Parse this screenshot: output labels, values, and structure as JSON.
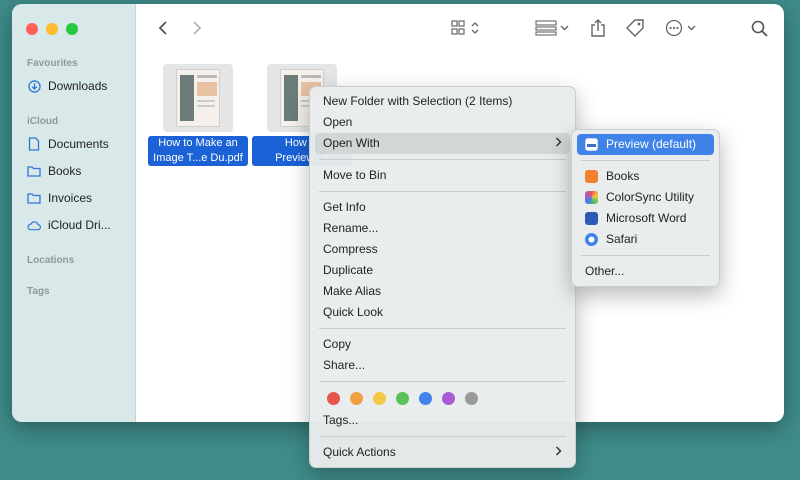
{
  "sidebar": {
    "favourites_title": "Favourites",
    "icloud_title": "iCloud",
    "locations_title": "Locations",
    "tags_title": "Tags",
    "items": [
      {
        "label": "Downloads",
        "icon": "download-circle-icon"
      },
      {
        "label": "Documents",
        "icon": "document-icon"
      },
      {
        "label": "Books",
        "icon": "folder-icon"
      },
      {
        "label": "Invoices",
        "icon": "folder-icon"
      },
      {
        "label": "iCloud Dri...",
        "icon": "cloud-icon"
      }
    ]
  },
  "files": [
    {
      "name": "How to Make an\nImage T...e Du.pdf"
    },
    {
      "name": "How to\nPreview...d"
    }
  ],
  "context_menu": {
    "new_folder": "New Folder with Selection (2 Items)",
    "open": "Open",
    "open_with": "Open With",
    "move_to_bin": "Move to Bin",
    "get_info": "Get Info",
    "rename": "Rename...",
    "compress": "Compress",
    "duplicate": "Duplicate",
    "make_alias": "Make Alias",
    "quick_look": "Quick Look",
    "copy": "Copy",
    "share": "Share...",
    "tags": "Tags...",
    "quick_actions": "Quick Actions",
    "tag_colors": [
      "#e5564c",
      "#f0a040",
      "#f4c842",
      "#5ac25a",
      "#3f83e8",
      "#a75bd4",
      "#9a9a9a"
    ]
  },
  "open_with_menu": {
    "preview": "Preview (default)",
    "books": "Books",
    "colorsync": "ColorSync Utility",
    "word": "Microsoft Word",
    "safari": "Safari",
    "other": "Other..."
  },
  "colors": {
    "accent": "#3f83e8",
    "selection": "#1a62d6",
    "traffic_close": "#fe5f57",
    "traffic_min": "#febc2e",
    "traffic_max": "#28c840"
  }
}
